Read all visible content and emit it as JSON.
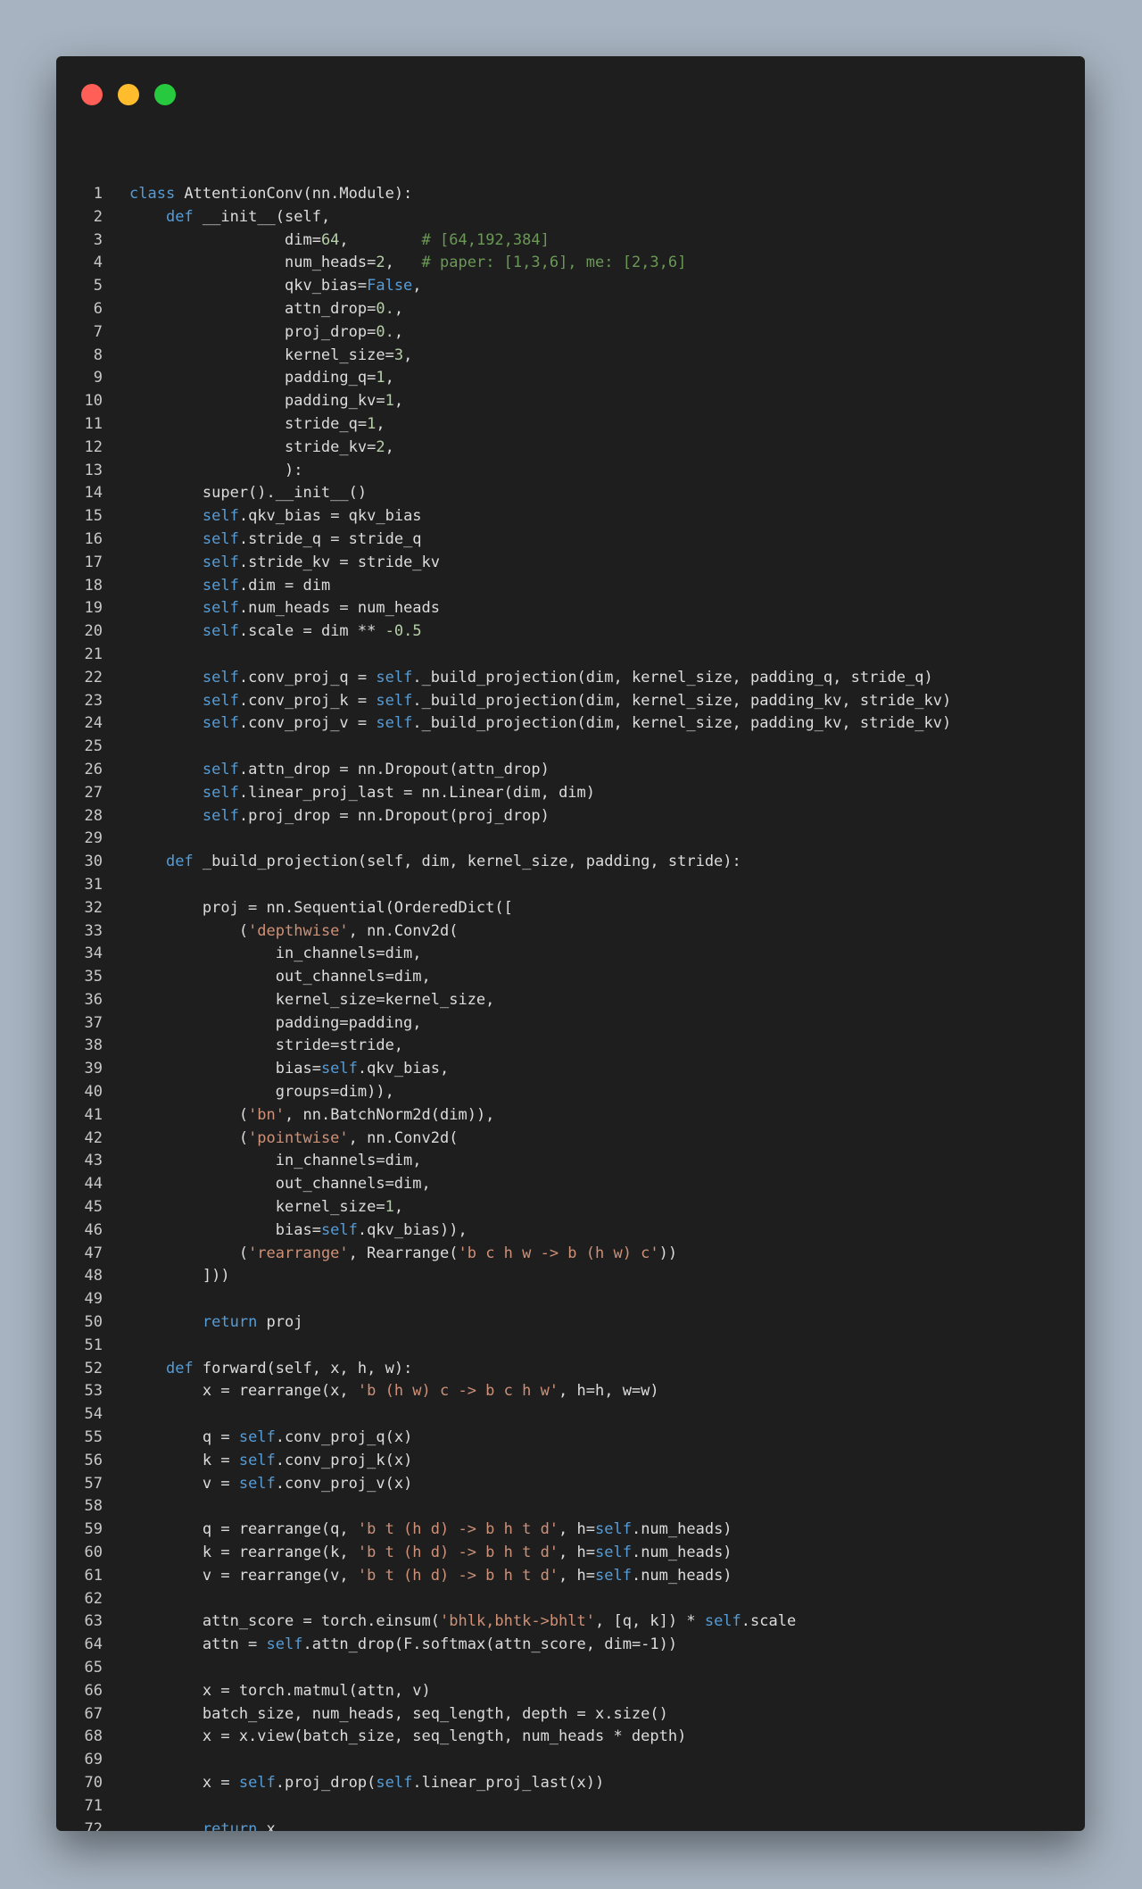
{
  "window": {
    "controls": [
      "close",
      "minimize",
      "maximize"
    ]
  },
  "colors": {
    "background": "#a7b3c0",
    "editor": "#1e1e1e",
    "text": "#dcdcdc",
    "keyword": "#569cd6",
    "comment": "#6a9955",
    "string": "#ce9178",
    "number": "#b5cea8"
  },
  "code_lines": [
    [
      [
        "kw",
        "class"
      ],
      [
        "t",
        " AttentionConv(nn.Module):"
      ]
    ],
    [
      [
        "t",
        "    "
      ],
      [
        "kw",
        "def"
      ],
      [
        "t",
        " __init__(self,"
      ]
    ],
    [
      [
        "t",
        "                 dim="
      ],
      [
        "num",
        "64"
      ],
      [
        "t",
        ",        "
      ],
      [
        "cm",
        "# [64,192,384]"
      ]
    ],
    [
      [
        "t",
        "                 num_heads="
      ],
      [
        "num",
        "2"
      ],
      [
        "t",
        ",   "
      ],
      [
        "cm",
        "# paper: [1,3,6], me: [2,3,6]"
      ]
    ],
    [
      [
        "t",
        "                 qkv_bias="
      ],
      [
        "kw",
        "False"
      ],
      [
        "t",
        ","
      ]
    ],
    [
      [
        "t",
        "                 attn_drop="
      ],
      [
        "num",
        "0."
      ],
      [
        "t",
        ","
      ]
    ],
    [
      [
        "t",
        "                 proj_drop="
      ],
      [
        "num",
        "0."
      ],
      [
        "t",
        ","
      ]
    ],
    [
      [
        "t",
        "                 kernel_size="
      ],
      [
        "num",
        "3"
      ],
      [
        "t",
        ","
      ]
    ],
    [
      [
        "t",
        "                 padding_q="
      ],
      [
        "num",
        "1"
      ],
      [
        "t",
        ","
      ]
    ],
    [
      [
        "t",
        "                 padding_kv="
      ],
      [
        "num",
        "1"
      ],
      [
        "t",
        ","
      ]
    ],
    [
      [
        "t",
        "                 stride_q="
      ],
      [
        "num",
        "1"
      ],
      [
        "t",
        ","
      ]
    ],
    [
      [
        "t",
        "                 stride_kv="
      ],
      [
        "num",
        "2"
      ],
      [
        "t",
        ","
      ]
    ],
    [
      [
        "t",
        "                 ):"
      ]
    ],
    [
      [
        "t",
        "        super().__init__()"
      ]
    ],
    [
      [
        "t",
        "        "
      ],
      [
        "kw",
        "self"
      ],
      [
        "t",
        ".qkv_bias = qkv_bias"
      ]
    ],
    [
      [
        "t",
        "        "
      ],
      [
        "kw",
        "self"
      ],
      [
        "t",
        ".stride_q = stride_q"
      ]
    ],
    [
      [
        "t",
        "        "
      ],
      [
        "kw",
        "self"
      ],
      [
        "t",
        ".stride_kv = stride_kv"
      ]
    ],
    [
      [
        "t",
        "        "
      ],
      [
        "kw",
        "self"
      ],
      [
        "t",
        ".dim = dim"
      ]
    ],
    [
      [
        "t",
        "        "
      ],
      [
        "kw",
        "self"
      ],
      [
        "t",
        ".num_heads = num_heads"
      ]
    ],
    [
      [
        "t",
        "        "
      ],
      [
        "kw",
        "self"
      ],
      [
        "t",
        ".scale = dim ** "
      ],
      [
        "num",
        "-0.5"
      ]
    ],
    [],
    [
      [
        "t",
        "        "
      ],
      [
        "kw",
        "self"
      ],
      [
        "t",
        ".conv_proj_q = "
      ],
      [
        "kw",
        "self"
      ],
      [
        "t",
        "._build_projection(dim, kernel_size, padding_q, stride_q)"
      ]
    ],
    [
      [
        "t",
        "        "
      ],
      [
        "kw",
        "self"
      ],
      [
        "t",
        ".conv_proj_k = "
      ],
      [
        "kw",
        "self"
      ],
      [
        "t",
        "._build_projection(dim, kernel_size, padding_kv, stride_kv)"
      ]
    ],
    [
      [
        "t",
        "        "
      ],
      [
        "kw",
        "self"
      ],
      [
        "t",
        ".conv_proj_v = "
      ],
      [
        "kw",
        "self"
      ],
      [
        "t",
        "._build_projection(dim, kernel_size, padding_kv, stride_kv)"
      ]
    ],
    [],
    [
      [
        "t",
        "        "
      ],
      [
        "kw",
        "self"
      ],
      [
        "t",
        ".attn_drop = nn.Dropout(attn_drop)"
      ]
    ],
    [
      [
        "t",
        "        "
      ],
      [
        "kw",
        "self"
      ],
      [
        "t",
        ".linear_proj_last = nn.Linear(dim, dim)"
      ]
    ],
    [
      [
        "t",
        "        "
      ],
      [
        "kw",
        "self"
      ],
      [
        "t",
        ".proj_drop = nn.Dropout(proj_drop)"
      ]
    ],
    [],
    [
      [
        "t",
        "    "
      ],
      [
        "kw",
        "def"
      ],
      [
        "t",
        " _build_projection(self, dim, kernel_size, padding, stride):"
      ]
    ],
    [],
    [
      [
        "t",
        "        proj = nn.Sequential(OrderedDict(["
      ]
    ],
    [
      [
        "t",
        "            ("
      ],
      [
        "str",
        "'depthwise'"
      ],
      [
        "t",
        ", nn.Conv2d("
      ]
    ],
    [
      [
        "t",
        "                in_channels=dim,"
      ]
    ],
    [
      [
        "t",
        "                out_channels=dim,"
      ]
    ],
    [
      [
        "t",
        "                kernel_size=kernel_size,"
      ]
    ],
    [
      [
        "t",
        "                padding=padding,"
      ]
    ],
    [
      [
        "t",
        "                stride=stride,"
      ]
    ],
    [
      [
        "t",
        "                bias="
      ],
      [
        "kw",
        "self"
      ],
      [
        "t",
        ".qkv_bias,"
      ]
    ],
    [
      [
        "t",
        "                groups=dim)),"
      ]
    ],
    [
      [
        "t",
        "            ("
      ],
      [
        "str",
        "'bn'"
      ],
      [
        "t",
        ", nn.BatchNorm2d(dim)),"
      ]
    ],
    [
      [
        "t",
        "            ("
      ],
      [
        "str",
        "'pointwise'"
      ],
      [
        "t",
        ", nn.Conv2d("
      ]
    ],
    [
      [
        "t",
        "                in_channels=dim,"
      ]
    ],
    [
      [
        "t",
        "                out_channels=dim,"
      ]
    ],
    [
      [
        "t",
        "                kernel_size="
      ],
      [
        "num",
        "1"
      ],
      [
        "t",
        ","
      ]
    ],
    [
      [
        "t",
        "                bias="
      ],
      [
        "kw",
        "self"
      ],
      [
        "t",
        ".qkv_bias)),"
      ]
    ],
    [
      [
        "t",
        "            ("
      ],
      [
        "str",
        "'rearrange'"
      ],
      [
        "t",
        ", Rearrange("
      ],
      [
        "str",
        "'b c h w -> b (h w) c'"
      ],
      [
        "t",
        "))"
      ]
    ],
    [
      [
        "t",
        "        ]))"
      ]
    ],
    [],
    [
      [
        "t",
        "        "
      ],
      [
        "kw",
        "return"
      ],
      [
        "t",
        " proj"
      ]
    ],
    [],
    [
      [
        "t",
        "    "
      ],
      [
        "kw",
        "def"
      ],
      [
        "t",
        " forward(self, x, h, w):"
      ]
    ],
    [
      [
        "t",
        "        x = rearrange(x, "
      ],
      [
        "str",
        "'b (h w) c -> b c h w'"
      ],
      [
        "t",
        ", h=h, w=w)"
      ]
    ],
    [],
    [
      [
        "t",
        "        q = "
      ],
      [
        "kw",
        "self"
      ],
      [
        "t",
        ".conv_proj_q(x)"
      ]
    ],
    [
      [
        "t",
        "        k = "
      ],
      [
        "kw",
        "self"
      ],
      [
        "t",
        ".conv_proj_k(x)"
      ]
    ],
    [
      [
        "t",
        "        v = "
      ],
      [
        "kw",
        "self"
      ],
      [
        "t",
        ".conv_proj_v(x)"
      ]
    ],
    [],
    [
      [
        "t",
        "        q = rearrange(q, "
      ],
      [
        "str",
        "'b t (h d) -> b h t d'"
      ],
      [
        "t",
        ", h="
      ],
      [
        "kw",
        "self"
      ],
      [
        "t",
        ".num_heads)"
      ]
    ],
    [
      [
        "t",
        "        k = rearrange(k, "
      ],
      [
        "str",
        "'b t (h d) -> b h t d'"
      ],
      [
        "t",
        ", h="
      ],
      [
        "kw",
        "self"
      ],
      [
        "t",
        ".num_heads)"
      ]
    ],
    [
      [
        "t",
        "        v = rearrange(v, "
      ],
      [
        "str",
        "'b t (h d) -> b h t d'"
      ],
      [
        "t",
        ", h="
      ],
      [
        "kw",
        "self"
      ],
      [
        "t",
        ".num_heads)"
      ]
    ],
    [],
    [
      [
        "t",
        "        attn_score = torch.einsum("
      ],
      [
        "str",
        "'bhlk,bhtk->bhlt'"
      ],
      [
        "t",
        ", [q, k]) * "
      ],
      [
        "kw",
        "self"
      ],
      [
        "t",
        ".scale"
      ]
    ],
    [
      [
        "t",
        "        attn = "
      ],
      [
        "kw",
        "self"
      ],
      [
        "t",
        ".attn_drop(F.softmax(attn_score, dim=-1))"
      ]
    ],
    [],
    [
      [
        "t",
        "        x = torch.matmul(attn, v)"
      ]
    ],
    [
      [
        "t",
        "        batch_size, num_heads, seq_length, depth = x.size()"
      ]
    ],
    [
      [
        "t",
        "        x = x.view(batch_size, seq_length, num_heads * depth)"
      ]
    ],
    [],
    [
      [
        "t",
        "        x = "
      ],
      [
        "kw",
        "self"
      ],
      [
        "t",
        ".proj_drop("
      ],
      [
        "kw",
        "self"
      ],
      [
        "t",
        ".linear_proj_last(x))"
      ]
    ],
    [],
    [
      [
        "t",
        "        "
      ],
      [
        "kw",
        "return"
      ],
      [
        "t",
        " x"
      ]
    ],
    []
  ]
}
